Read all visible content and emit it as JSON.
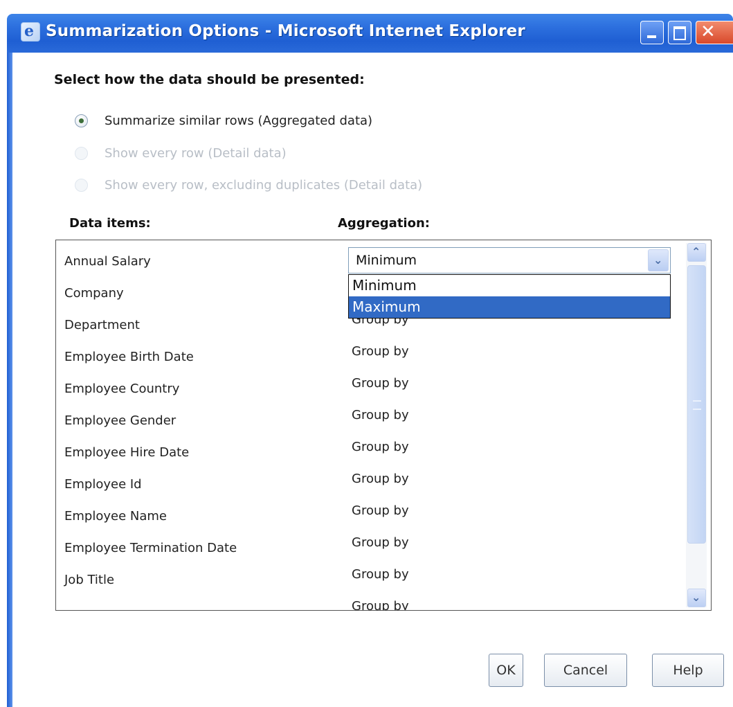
{
  "window": {
    "title": "Summarization Options - Microsoft Internet Explorer"
  },
  "presentation": {
    "heading": "Select how the data should be presented:",
    "options": [
      {
        "label": "Summarize similar rows (Aggregated data)",
        "checked": true,
        "enabled": true
      },
      {
        "label": "Show every row (Detail data)",
        "checked": false,
        "enabled": false
      },
      {
        "label": "Show every row, excluding duplicates (Detail data)",
        "checked": false,
        "enabled": false
      }
    ]
  },
  "table": {
    "headers": {
      "data_items": "Data items:",
      "aggregation": "Aggregation:"
    },
    "rows": [
      {
        "name": "Annual Salary",
        "aggregation": "Minimum"
      },
      {
        "name": "Company",
        "aggregation": ""
      },
      {
        "name": "Department",
        "aggregation": "Group by"
      },
      {
        "name": "Employee Birth Date",
        "aggregation": "Group by"
      },
      {
        "name": "Employee Country",
        "aggregation": "Group by"
      },
      {
        "name": "Employee Gender",
        "aggregation": "Group by"
      },
      {
        "name": "Employee Hire Date",
        "aggregation": "Group by"
      },
      {
        "name": "Employee Id",
        "aggregation": "Group by"
      },
      {
        "name": "Employee Name",
        "aggregation": "Group by"
      },
      {
        "name": "Employee Termination Date",
        "aggregation": "Group by"
      },
      {
        "name": "Job Title",
        "aggregation": "Group by"
      },
      {
        "name": "",
        "aggregation": "Group by"
      }
    ],
    "dropdown": {
      "value": "Minimum",
      "options": [
        "Minimum",
        "Maximum"
      ],
      "highlighted": "Maximum"
    }
  },
  "buttons": {
    "ok": "OK",
    "cancel": "Cancel",
    "help": "Help"
  },
  "colors": {
    "titlebar": "#2c6fde",
    "selection": "#316ac5"
  }
}
